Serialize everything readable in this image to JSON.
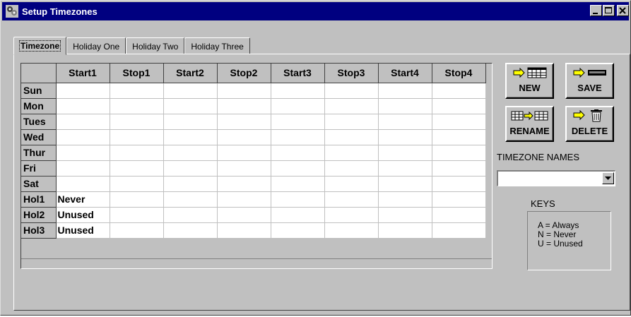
{
  "window": {
    "title": "Setup Timezones",
    "icon": "setup-app-icon",
    "controls": [
      "minimize-icon",
      "maximize-icon",
      "close-icon"
    ]
  },
  "tabs": [
    {
      "label": "Timezone",
      "active": true
    },
    {
      "label": "Holiday One",
      "active": false
    },
    {
      "label": "Holiday Two",
      "active": false
    },
    {
      "label": "Holiday Three",
      "active": false
    }
  ],
  "grid": {
    "columns": [
      "Start1",
      "Stop1",
      "Start2",
      "Stop2",
      "Start3",
      "Stop3",
      "Start4",
      "Stop4"
    ],
    "rows": [
      {
        "label": "Sun",
        "cells": [
          "",
          "",
          "",
          "",
          "",
          "",
          "",
          ""
        ]
      },
      {
        "label": "Mon",
        "cells": [
          "",
          "",
          "",
          "",
          "",
          "",
          "",
          ""
        ]
      },
      {
        "label": "Tues",
        "cells": [
          "",
          "",
          "",
          "",
          "",
          "",
          "",
          ""
        ]
      },
      {
        "label": "Wed",
        "cells": [
          "",
          "",
          "",
          "",
          "",
          "",
          "",
          ""
        ]
      },
      {
        "label": "Thur",
        "cells": [
          "",
          "",
          "",
          "",
          "",
          "",
          "",
          ""
        ]
      },
      {
        "label": "Fri",
        "cells": [
          "",
          "",
          "",
          "",
          "",
          "",
          "",
          ""
        ]
      },
      {
        "label": "Sat",
        "cells": [
          "",
          "",
          "",
          "",
          "",
          "",
          "",
          ""
        ]
      },
      {
        "label": "Hol1",
        "cells": [
          "Never",
          "",
          "",
          "",
          "",
          "",
          "",
          ""
        ]
      },
      {
        "label": "Hol2",
        "cells": [
          "Unused",
          "",
          "",
          "",
          "",
          "",
          "",
          ""
        ]
      },
      {
        "label": "Hol3",
        "cells": [
          "Unused",
          "",
          "",
          "",
          "",
          "",
          "",
          ""
        ]
      }
    ]
  },
  "buttons": {
    "new": {
      "label": "NEW",
      "icon": "arrow-to-grid-icon"
    },
    "save": {
      "label": "SAVE",
      "icon": "arrow-to-disk-icon"
    },
    "rename": {
      "label": "RENAME",
      "icon": "grid-arrow-grid-icon"
    },
    "delete": {
      "label": "DELETE",
      "icon": "arrow-to-trash-icon"
    }
  },
  "timezone_names": {
    "label": "TIMEZONE NAMES",
    "selected": ""
  },
  "keys": {
    "label": "KEYS",
    "items": [
      "A = Always",
      "N = Never",
      "U = Unused"
    ]
  },
  "colors": {
    "titlebar": "#000080",
    "face": "#c0c0c0",
    "arrow": "#ffff00"
  }
}
